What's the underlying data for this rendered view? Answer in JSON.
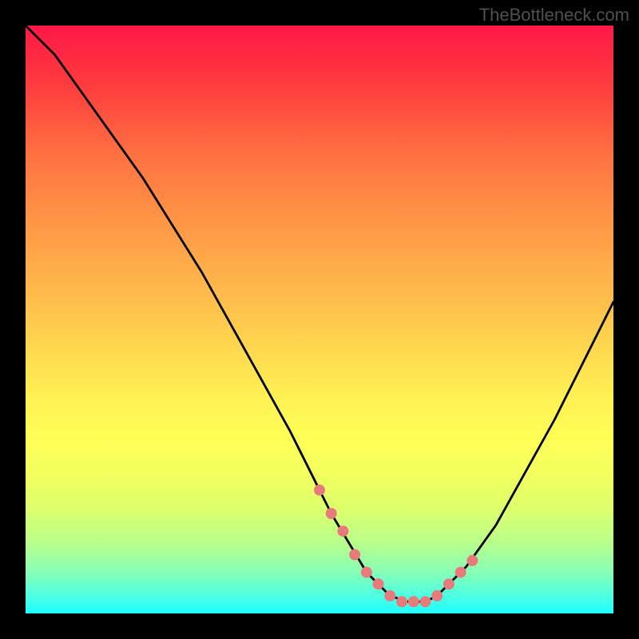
{
  "watermark": "TheBottleneck.com",
  "chart_data": {
    "type": "line",
    "title": "",
    "xlabel": "",
    "ylabel": "",
    "xlim": [
      0,
      100
    ],
    "ylim": [
      0,
      100
    ],
    "curve": {
      "name": "bottleneck-curve",
      "x": [
        0,
        5,
        10,
        15,
        20,
        25,
        30,
        35,
        40,
        45,
        50,
        52,
        55,
        58,
        60,
        62,
        65,
        68,
        70,
        75,
        80,
        85,
        90,
        95,
        100
      ],
      "y": [
        100,
        95,
        88,
        81,
        74,
        66,
        58,
        49,
        40,
        31,
        21,
        17,
        12,
        7,
        5,
        3,
        2,
        2,
        3,
        8,
        15,
        24,
        33,
        43,
        53
      ]
    },
    "markers": {
      "name": "highlight-points",
      "color": "#e77b7b",
      "x": [
        50,
        52,
        54,
        56,
        58,
        60,
        62,
        64,
        66,
        68,
        70,
        72,
        74,
        76
      ],
      "y": [
        21,
        17,
        14,
        10,
        7,
        5,
        3,
        2,
        2,
        2,
        3,
        5,
        7,
        9
      ]
    }
  }
}
